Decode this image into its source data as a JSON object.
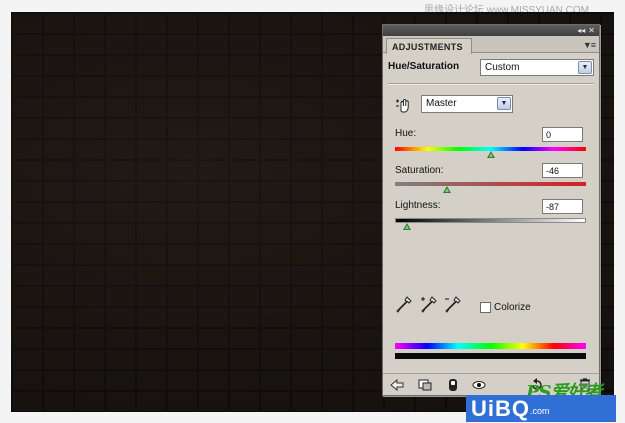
{
  "watermark_top": "思缘设计论坛  www.MISSYUAN.COM",
  "watermark_bottom": {
    "logo": "PS爱好者",
    "site": "UiBQ",
    "site_suffix": ".com"
  },
  "panel": {
    "controls": {
      "collapse": "◂◂",
      "close": "✕"
    },
    "tab_label": "ADJUSTMENTS",
    "menu_icon": "panel-menu-icon",
    "adjustment_name": "Hue/Saturation",
    "preset": {
      "selected": "Custom"
    },
    "channel": {
      "selected": "Master"
    },
    "sliders": {
      "hue": {
        "label": "Hue:",
        "value": "0",
        "position": 0.5
      },
      "saturation": {
        "label": "Saturation:",
        "value": "-46",
        "position": 0.27
      },
      "lightness": {
        "label": "Lightness:",
        "value": "-87",
        "position": 0.065
      }
    },
    "colorize": {
      "label": "Colorize",
      "checked": false
    },
    "icons": {
      "targeted_adjustment": "hand-target-icon",
      "eyedropper": "eyedropper-icon",
      "eyedropper_plus": "eyedropper-plus-icon",
      "eyedropper_minus": "eyedropper-minus-icon",
      "bottom_bar": [
        "back-arrow-icon",
        "clip-layer-icon",
        "mask-toggle-icon",
        "visibility-eye-icon",
        "reset-icon",
        "delete-icon"
      ]
    }
  },
  "colors": {
    "canvas": "#191410",
    "panel_bg": "#d4d0c8",
    "thumb": "#2e7d2e",
    "watermark_green": "#2c9b1e",
    "watermark_blue": "#2f6fd6"
  }
}
